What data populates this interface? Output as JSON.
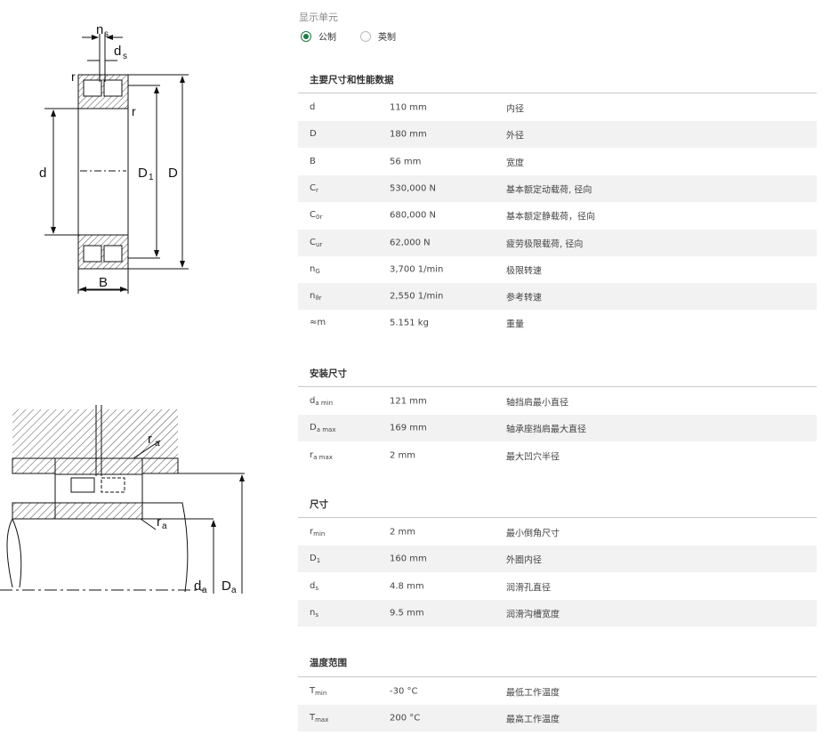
{
  "units": {
    "title": "显示单元",
    "options": [
      {
        "label": "公制",
        "selected": true
      },
      {
        "label": "英制",
        "selected": false
      }
    ]
  },
  "drawing": {
    "top_labels": [
      "n",
      "s",
      "d",
      "s",
      "r",
      "r",
      "d",
      "D",
      "1",
      "D",
      "B"
    ],
    "bottom_labels": [
      "r",
      "a",
      "r",
      "a",
      "d",
      "a",
      "D",
      "a"
    ]
  },
  "sections": [
    {
      "title": "主要尺寸和性能数据",
      "rows": [
        {
          "sym": "d",
          "sub": "",
          "value": "110 mm",
          "desc": "内径"
        },
        {
          "sym": "D",
          "sub": "",
          "value": "180 mm",
          "desc": "外径"
        },
        {
          "sym": "B",
          "sub": "",
          "value": "56 mm",
          "desc": "宽度"
        },
        {
          "sym": "C",
          "sub": "r",
          "value": "530,000 N",
          "desc": "基本额定动载荷, 径向"
        },
        {
          "sym": "C",
          "sub": "0r",
          "value": "680,000 N",
          "desc": "基本额定静载荷，径向"
        },
        {
          "sym": "C",
          "sub": "ur",
          "value": "62,000 N",
          "desc": "疲劳极限载荷, 径向"
        },
        {
          "sym": "n",
          "sub": "G",
          "value": "3,700 1/min",
          "desc": "极限转速"
        },
        {
          "sym": "n",
          "sub": "ϑr",
          "value": "2,550 1/min",
          "desc": "参考转速"
        },
        {
          "sym": "≈m",
          "sub": "",
          "value": "5.151 kg",
          "desc": "重量"
        }
      ]
    },
    {
      "title": "安装尺寸",
      "rows": [
        {
          "sym": "d",
          "sub": "a min",
          "value": "121 mm",
          "desc": "轴挡肩最小直径"
        },
        {
          "sym": "D",
          "sub": "a max",
          "value": "169 mm",
          "desc": "轴承座挡肩最大直径"
        },
        {
          "sym": "r",
          "sub": "a max",
          "value": "2 mm",
          "desc": "最大凹穴半径"
        }
      ]
    },
    {
      "title": "尺寸",
      "rows": [
        {
          "sym": "r",
          "sub": "min",
          "value": "2 mm",
          "desc": "最小倒角尺寸"
        },
        {
          "sym": "D",
          "sub": "1",
          "value": "160 mm",
          "desc": "外圈内径"
        },
        {
          "sym": "d",
          "sub": "s",
          "value": "4.8 mm",
          "desc": "润滑孔直径"
        },
        {
          "sym": "n",
          "sub": "s",
          "value": "9.5 mm",
          "desc": "润滑沟槽宽度"
        }
      ]
    },
    {
      "title": "温度范围",
      "rows": [
        {
          "sym": "T",
          "sub": "min",
          "value": "-30 °C",
          "desc": "最低工作温度"
        },
        {
          "sym": "T",
          "sub": "max",
          "value": "200 °C",
          "desc": "最高工作温度"
        }
      ]
    }
  ]
}
